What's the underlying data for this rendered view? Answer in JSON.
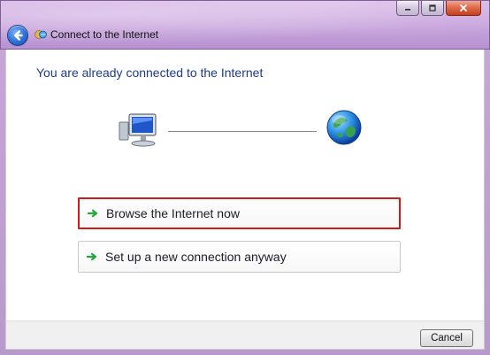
{
  "window": {
    "title": "Connect to the Internet",
    "controls": [
      "minimize",
      "maximize",
      "close"
    ]
  },
  "main": {
    "headline": "You are already connected to the Internet",
    "options": [
      {
        "label": "Browse the Internet now",
        "selected": true
      },
      {
        "label": "Set up a new connection anyway",
        "selected": false
      }
    ]
  },
  "footer": {
    "cancel_label": "Cancel"
  },
  "icons": {
    "back": "back-arrow-icon",
    "title": "network-icon",
    "computer": "computer-icon",
    "globe": "globe-icon",
    "option_arrow": "green-arrow-icon"
  },
  "colors": {
    "headline": "#1e3b8a",
    "selected_border": "#d11b1b",
    "arrow_green": "#22a83a"
  }
}
